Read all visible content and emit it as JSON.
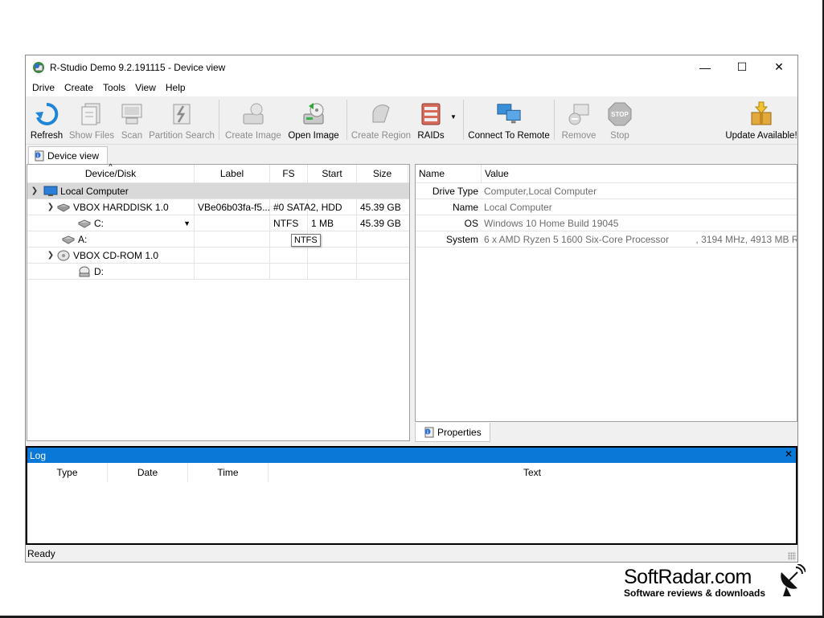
{
  "window": {
    "title": "R-Studio Demo 9.2.191115 - Device view",
    "controls": {
      "minimize": "—",
      "maximize": "☐",
      "close": "✕"
    }
  },
  "menu": [
    "Drive",
    "Create",
    "Tools",
    "View",
    "Help"
  ],
  "toolbar": {
    "refresh": "Refresh",
    "show_files": "Show Files",
    "scan": "Scan",
    "partition_search": "Partition Search",
    "create_image": "Create Image",
    "open_image": "Open Image",
    "create_region": "Create Region",
    "raids": "RAIDs",
    "connect_remote": "Connect To Remote",
    "remove": "Remove",
    "stop": "Stop",
    "update": "Update Available!"
  },
  "tab": {
    "label": "Device view"
  },
  "devices": {
    "columns": [
      "Device/Disk",
      "Label",
      "FS",
      "Start",
      "Size"
    ],
    "rows": [
      {
        "name": "Local Computer",
        "label": "",
        "fs": "",
        "start": "",
        "size": ""
      },
      {
        "name": "VBOX HARDDISK 1.0",
        "label": "VBe06b03fa-f5...",
        "fs": "#0 SATA2, HDD",
        "start": "",
        "size": "45.39 GB"
      },
      {
        "name": "C:",
        "label": "",
        "fs": "NTFS",
        "start": "1 MB",
        "size": "45.39 GB"
      },
      {
        "name": "A:",
        "label": "",
        "fs": "",
        "start": "",
        "size": ""
      },
      {
        "name": "VBOX CD-ROM 1.0",
        "label": "",
        "fs": "",
        "start": "",
        "size": ""
      },
      {
        "name": "D:",
        "label": "",
        "fs": "",
        "start": "",
        "size": ""
      }
    ],
    "tooltip": "NTFS"
  },
  "properties": {
    "columns": [
      "Name",
      "Value"
    ],
    "rows": [
      {
        "name": "Drive Type",
        "value": "Computer,Local Computer"
      },
      {
        "name": "Name",
        "value": "Local Computer"
      },
      {
        "name": "OS",
        "value": "Windows 10 Home Build 19045"
      },
      {
        "name": "System",
        "value": "6 x AMD Ryzen 5 1600 Six-Core Processor          , 3194 MHz, 4913 MB R..."
      }
    ],
    "tab_label": "Properties"
  },
  "log": {
    "title": "Log",
    "close": "✕",
    "columns": [
      "Type",
      "Date",
      "Time",
      "Text"
    ]
  },
  "status": "Ready",
  "watermark": {
    "logo": "SoftRadar.com",
    "tagline": "Software reviews & downloads"
  },
  "colors": {
    "accent": "#0a78d7",
    "selected_row": "#d9d9d9",
    "disabled_text": "#8c8c8c"
  }
}
